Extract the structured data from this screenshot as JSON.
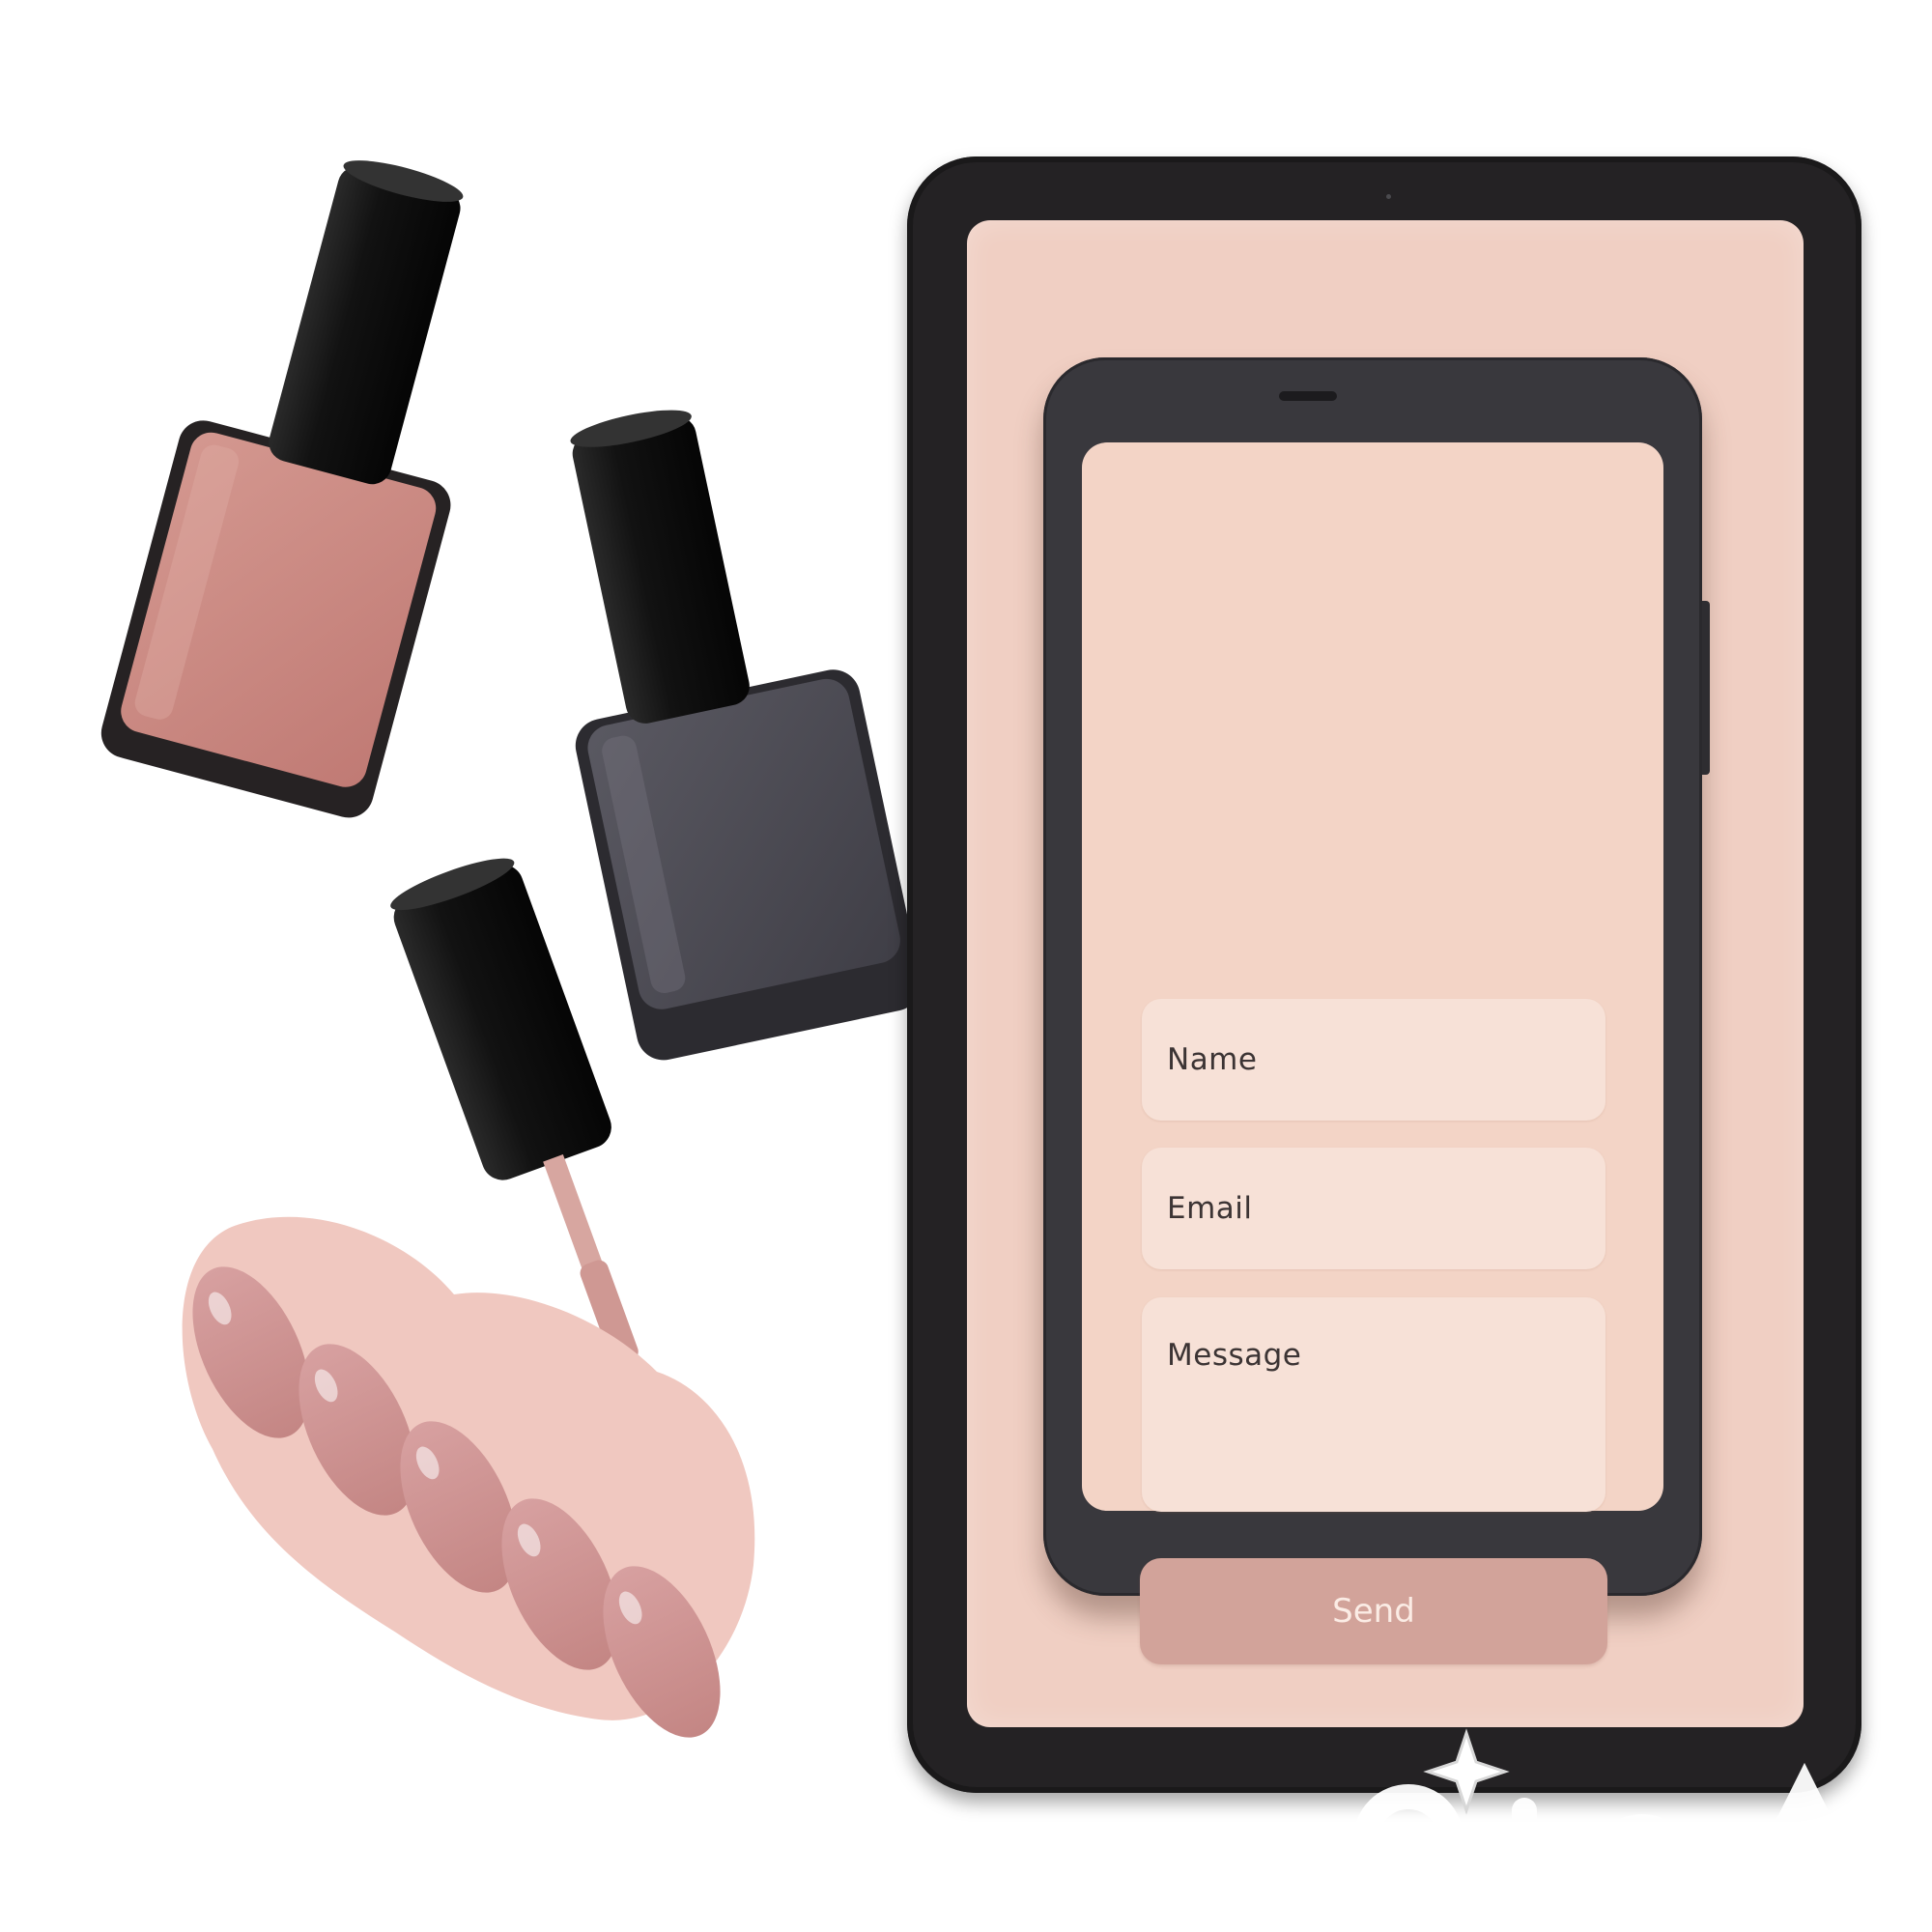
{
  "form": {
    "name_placeholder": "Name",
    "email_placeholder": "Email",
    "message_placeholder": "Message",
    "send_label": "Send"
  },
  "colors": {
    "page_background": "#ffffff",
    "tablet_bezel": "#242224",
    "tablet_screen": "#f0cfc3",
    "phone_bezel": "#39383d",
    "phone_screen": "#f3d4c6",
    "input_background": "#f7e1d7",
    "send_button": "#d2a39a",
    "polish_rose": "#c98680",
    "polish_slate": "#4a4950",
    "nail_pink": "#c99090"
  },
  "decor": {
    "illustration_items": [
      "nail-polish-bottle-rose",
      "nail-polish-bottle-slate",
      "nail-polish-brush-cap",
      "nail-swatch-hand"
    ],
    "watermark": "watermark-logo"
  }
}
